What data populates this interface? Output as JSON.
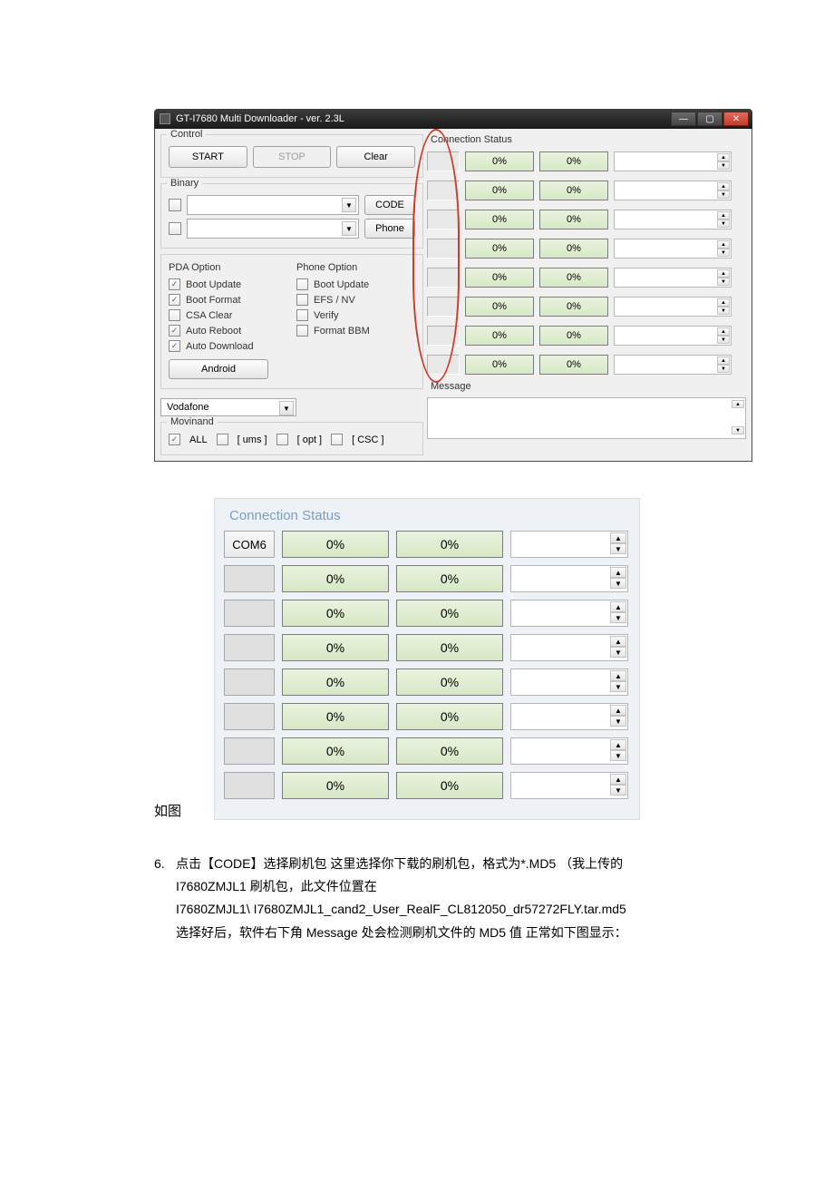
{
  "window": {
    "title": "GT-I7680 Multi Downloader - ver. 2.3L",
    "control_label": "Control",
    "buttons": {
      "start": "START",
      "stop": "STOP",
      "clear": "Clear"
    },
    "binary_label": "Binary",
    "code_btn": "CODE",
    "phone_btn": "Phone",
    "pda_option_label": "PDA Option",
    "phone_option_label": "Phone Option",
    "pda_opts": [
      {
        "label": "Boot Update",
        "checked": true
      },
      {
        "label": "Boot Format",
        "checked": true
      },
      {
        "label": "CSA Clear",
        "checked": false
      },
      {
        "label": "Auto Reboot",
        "checked": true
      },
      {
        "label": "Auto Download",
        "checked": true
      }
    ],
    "phone_opts": [
      {
        "label": "Boot Update",
        "checked": false
      },
      {
        "label": "EFS / NV",
        "checked": false
      },
      {
        "label": "Verify",
        "checked": false
      },
      {
        "label": "Format BBM",
        "checked": false
      }
    ],
    "android_btn": "Android",
    "carrier": "Vodafone",
    "movinand_label": "Movinand",
    "mov_opts": {
      "all": {
        "label": "ALL",
        "checked": true
      },
      "ums": {
        "label": "[ ums ]",
        "checked": false
      },
      "opt": {
        "label": "[ opt ]",
        "checked": false
      },
      "csc": {
        "label": "[ CSC ]",
        "checked": false
      }
    },
    "cs_label": "Connection Status",
    "msg_label": "Message",
    "progress": {
      "a": "0%",
      "b": "0%"
    },
    "rows": 8
  },
  "zoom": {
    "title": "Connection Status",
    "port1": "COM6",
    "progress": {
      "a": "0%",
      "b": "0%"
    },
    "rows": 8
  },
  "caption": "如图",
  "body": {
    "step_num": "6.",
    "l1": "点击【CODE】选择刷机包   这里选择你下载的刷机包，格式为*.MD5 （我上传的",
    "l2": "I7680ZMJL1 刷机包，此文件位置在",
    "l3": "I7680ZMJL1\\ I7680ZMJL1_cand2_User_RealF_CL812050_dr57272FLY.tar.md5",
    "l4": "选择好后，软件右下角 Message 处会检测刷机文件的 MD5 值  正常如下图显示："
  }
}
